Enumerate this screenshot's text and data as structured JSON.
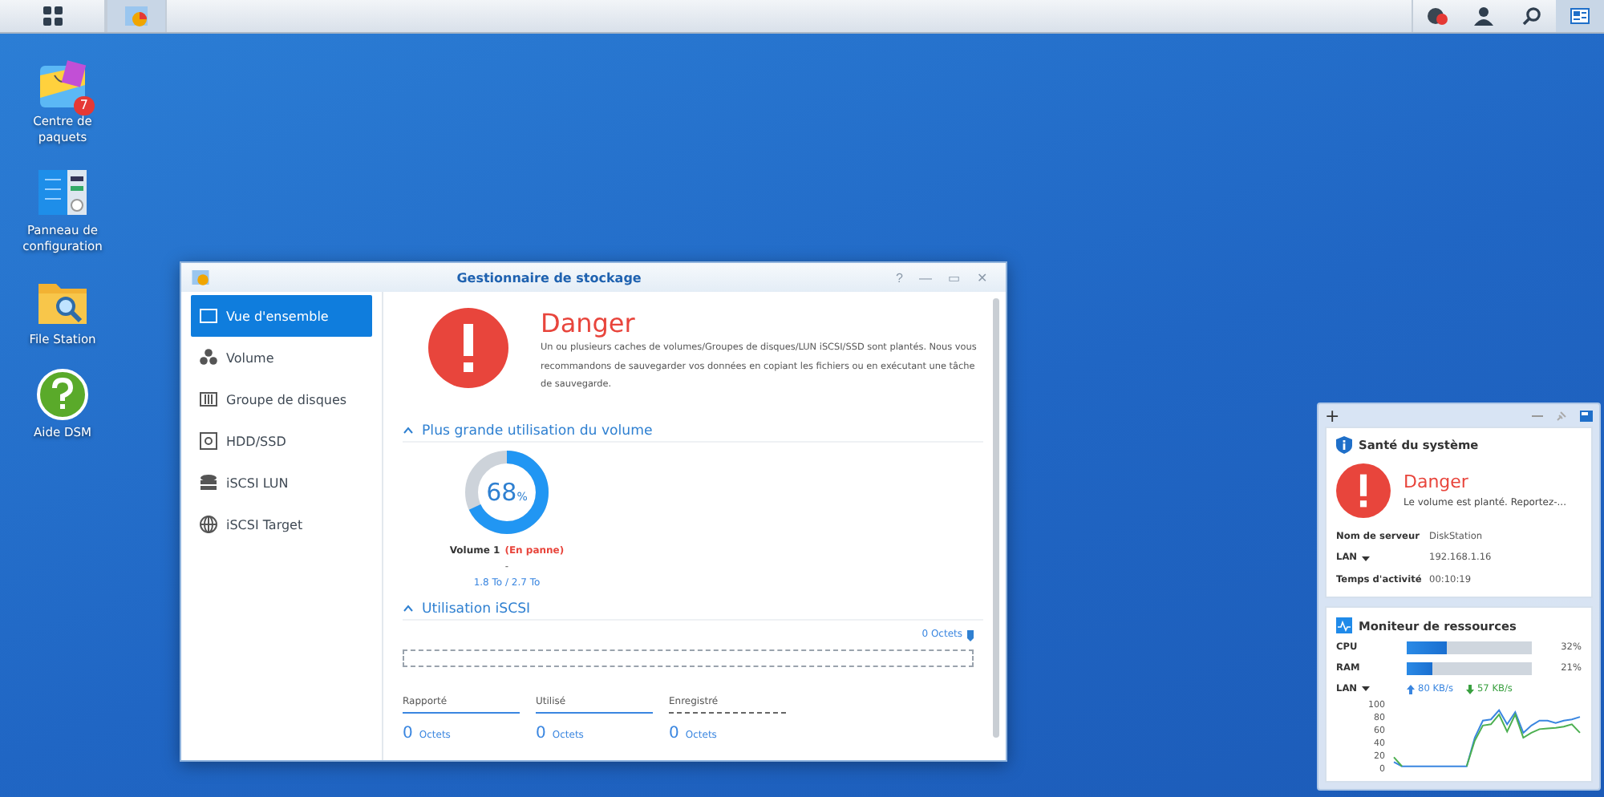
{
  "taskbar": {
    "notification_badge": true
  },
  "desktop_icons": [
    {
      "kind": "package",
      "label": "Centre de paquets",
      "badge": "7"
    },
    {
      "kind": "control",
      "label": "Panneau de configuration"
    },
    {
      "kind": "folder",
      "label": "File Station"
    },
    {
      "kind": "help",
      "label": "Aide DSM"
    }
  ],
  "window": {
    "title": "Gestionnaire de stockage",
    "controls": [
      "?",
      "—",
      "▭",
      "✕"
    ],
    "sidebar": [
      {
        "kind": "overview",
        "label": "Vue d'ensemble",
        "selected": true
      },
      {
        "kind": "volume",
        "label": "Volume",
        "selected": false
      },
      {
        "kind": "group",
        "label": "Groupe de disques",
        "selected": false
      },
      {
        "kind": "disk",
        "label": "HDD/SSD",
        "selected": false
      },
      {
        "kind": "lun",
        "label": "iSCSI LUN",
        "selected": false
      },
      {
        "kind": "target",
        "label": "iSCSI Target",
        "selected": false
      }
    ],
    "status": {
      "title": "Danger",
      "message": "Un ou plusieurs caches de volumes/Groupes de disques/LUN iSCSI/SSD sont plantés. Nous vous recommandons de sauvegarder vos données en copiant les fichiers ou en exécutant une tâche de sauvegarde."
    },
    "volume_section": {
      "heading": "Plus grande utilisation du volume",
      "expanded": true,
      "level": 0.68,
      "percent": "68",
      "unit": "%",
      "volume_name": "Volume 1",
      "volume_state": "(En panne)",
      "dash": "-",
      "capacity": "1.8 To / 2.7 To"
    },
    "iscsi_section": {
      "heading": "Utilisation iSCSI",
      "expanded": true,
      "total": "0 Octets",
      "stats": [
        {
          "label": "Rapporté",
          "value": "0",
          "unit": "Octets",
          "kind": "reported"
        },
        {
          "label": "Utilisé",
          "value": "0",
          "unit": "Octets",
          "kind": "used"
        },
        {
          "label": "Enregistré",
          "value": "0",
          "unit": "Octets",
          "kind": "saved"
        }
      ]
    }
  },
  "widgets": {
    "add": "+",
    "health": {
      "title": "Santé du système",
      "status": "Danger",
      "message": "Le volume est planté. Reportez-...",
      "rows": [
        {
          "label": "Nom de serveur",
          "value": "DiskStation",
          "dropdown": false
        },
        {
          "label": "LAN",
          "value": "192.168.1.16",
          "dropdown": true
        },
        {
          "label": "Temps d'activité",
          "value": "00:10:19",
          "dropdown": false
        }
      ]
    },
    "monitor": {
      "title": "Moniteur de ressources",
      "meters": [
        {
          "label": "CPU",
          "level": 0.32,
          "reading": "32%"
        },
        {
          "label": "RAM",
          "level": 0.21,
          "reading": "21%"
        }
      ],
      "lan_label": "LAN",
      "upload": "80 KB/s",
      "download": "57 KB/s",
      "chart_data": {
        "type": "line",
        "ylim": [
          0,
          100
        ],
        "yticks": [
          0,
          20,
          40,
          60,
          80,
          100
        ],
        "series": [
          {
            "color": "#3a86e0",
            "values": [
              10,
              3,
              3,
              3,
              3,
              3,
              3,
              3,
              3,
              3,
              50,
              78,
              80,
              95,
              72,
              92,
              58,
              70,
              78,
              78,
              74,
              78,
              80,
              84
            ]
          },
          {
            "color": "#4caf50",
            "values": [
              18,
              3,
              null,
              null,
              null,
              null,
              null,
              null,
              null,
              3,
              45,
              70,
              72,
              88,
              60,
              88,
              50,
              58,
              64,
              65,
              66,
              68,
              72,
              58
            ]
          }
        ]
      }
    }
  }
}
